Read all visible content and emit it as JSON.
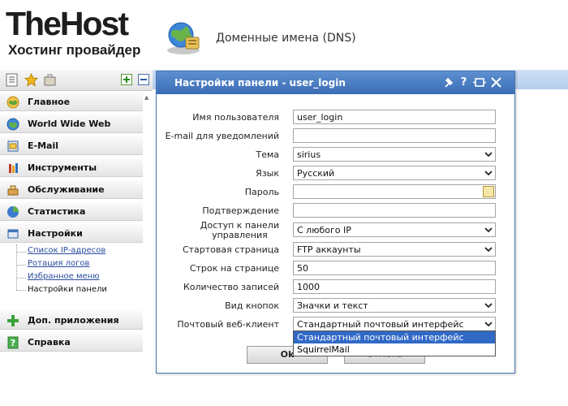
{
  "header": {
    "logo_main": "TheHost",
    "logo_sub": "Хостинг провайдер",
    "section_title": "Доменные имена (DNS)",
    "section_icon": "globe-network-icon"
  },
  "sidebar": {
    "toolbar": [
      {
        "name": "list-view-icon"
      },
      {
        "name": "favorites-star-icon"
      },
      {
        "name": "briefcase-icon"
      },
      {
        "name": "expand-all-icon",
        "glyph": "+"
      },
      {
        "name": "collapse-all-icon",
        "glyph": "−"
      }
    ],
    "items": [
      {
        "label": "Главное",
        "icon": "home-globe-icon"
      },
      {
        "label": "World Wide Web",
        "icon": "www-globe-icon"
      },
      {
        "label": "E-Mail",
        "icon": "mail-icon"
      },
      {
        "label": "Инструменты",
        "icon": "tools-icon"
      },
      {
        "label": "Обслуживание",
        "icon": "maintenance-icon"
      },
      {
        "label": "Статистика",
        "icon": "statistics-pie-icon"
      },
      {
        "label": "Настройки",
        "icon": "settings-icon"
      },
      {
        "label": "Доп. приложения",
        "icon": "plus-apps-icon"
      },
      {
        "label": "Справка",
        "icon": "help-icon"
      }
    ],
    "settings_submenu": [
      {
        "label": "Список IP-адресов",
        "current": false
      },
      {
        "label": "Ротация логов",
        "current": false
      },
      {
        "label": "Избранное меню",
        "current": false
      },
      {
        "label": "Настройки панели",
        "current": true
      }
    ]
  },
  "dialog": {
    "title": "Настройки панели - user_login",
    "tools": [
      "pin-icon",
      "help-icon",
      "maximize-icon",
      "close-icon"
    ],
    "fields": {
      "username": {
        "label": "Имя пользователя",
        "value": "user_login"
      },
      "email": {
        "label": "E-mail для уведомлений",
        "value": ""
      },
      "theme": {
        "label": "Тема",
        "value": "sirius"
      },
      "language": {
        "label": "Язык",
        "value": "Русский"
      },
      "password": {
        "label": "Пароль",
        "value": ""
      },
      "confirm": {
        "label": "Подтверждение",
        "value": ""
      },
      "access_line1": "Доступ к панели",
      "access_line2": "управления",
      "access_value": "С любого IP",
      "start_page": {
        "label": "Стартовая страница",
        "value": "FTP аккаунты"
      },
      "rows_per_page": {
        "label": "Строк на странице",
        "value": "50"
      },
      "records_count": {
        "label": "Количество записей",
        "value": "1000"
      },
      "button_view": {
        "label": "Вид кнопок",
        "value": "Значки и текст"
      },
      "webmail": {
        "label": "Почтовый веб-клиент",
        "value": "Стандартный почтовый интерфейс"
      }
    },
    "webmail_options": [
      {
        "label": "Стандартный почтовый интерфейс",
        "selected": true
      },
      {
        "label": "SquirrelMail",
        "selected": false
      }
    ],
    "buttons": {
      "ok": "Ok",
      "cancel": "Отмена"
    }
  },
  "colors": {
    "accent": "#3a6db5",
    "title_bar_top": "#5d8fd1",
    "selection": "#3169c6",
    "link": "#2a4c9e"
  }
}
